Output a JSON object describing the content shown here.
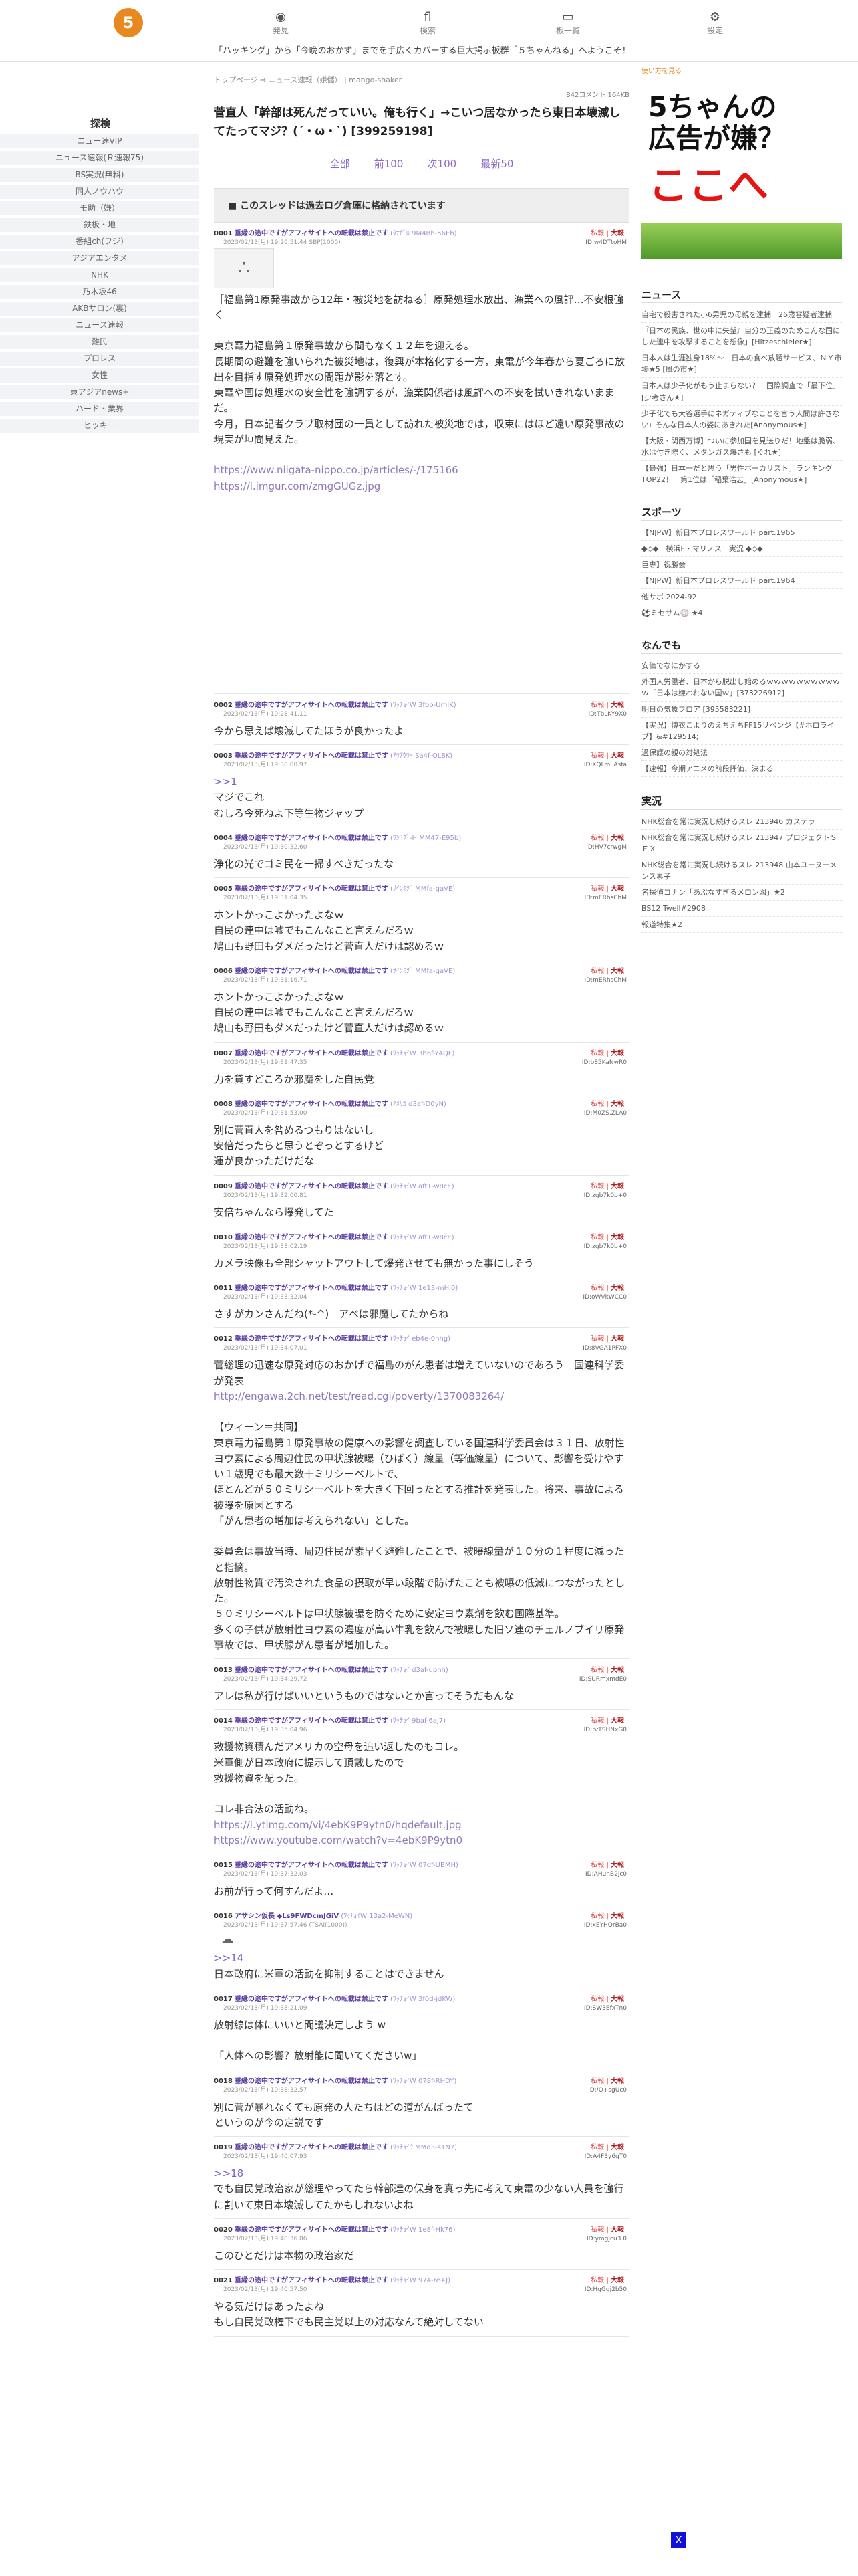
{
  "header": {
    "logo_char": "5",
    "nav": [
      {
        "label": "発見",
        "icon": "◉"
      },
      {
        "label": "検索",
        "icon": "fl"
      },
      {
        "label": "板一覧",
        "icon": "▭"
      },
      {
        "label": "設定",
        "icon": "⚙"
      }
    ],
    "ticker": "「ハッキング」から「今晩のおかず」までを手広くカバーする巨大掲示板群「５ちゃんねる」へようこそ！"
  },
  "left_sidebar": {
    "title": "探検",
    "items": [
      "ニュー速VIP",
      "ニュース速報(Ｒ速報75)",
      "BS実況(無料)",
      "同人ノウハウ",
      "モ助（嫌）",
      "鉄板・地",
      "番組ch(フジ)",
      "アジアエンタメ",
      "NHK",
      "乃木坂46",
      "AKBサロン(裏)",
      "ニュース速報",
      "難民",
      "プロレス",
      "女性",
      "東アジアnews+",
      "ハード・業界",
      "ヒッキー"
    ]
  },
  "main": {
    "breadcrumb": [
      "トップページ",
      "ニュース速報（嫌儲）",
      "mango-shaker"
    ],
    "meta": "842コメント 164KB",
    "title": "菅直人「幹部は死んだっていい。俺も行く」→こいつ居なかったら東日本壊滅してたってマジ？(´・ω・`) [399259198]",
    "jumps": [
      "全部",
      "前100",
      "次100",
      "最新50"
    ],
    "archive_notice": "このスレッドは過去ログ倉庫に格納されています",
    "res_actions": {
      "r1": "私報",
      "r2": "大報"
    },
    "posts": [
      {
        "no": "0001",
        "name": "垂縁の途中ですがアフィサイトへの転載は禁止です",
        "trip": "(ﾀﾅｶﾞﾛ 9M4Bb-56Eh)",
        "date": "2023/02/13(月) 19:20:51.44 SBP(1000)",
        "id": "ID:w4DTtoHM",
        "thumb": "∴",
        "body": [
          "［福島第1原発事故から12年・被災地を訪ねる］原発処理水放出、漁業への風評…不安根強く",
          "",
          "東京電力福島第１原発事故から間もなく１２年を迎える。",
          "長期間の避難を強いられた被災地は，復興が本格化する一方，東電が今年春から夏ごろに放出を目指す原発処理水の問題が影を落とす。",
          "東電や国は処理水の安全性を強調するが，漁業関係者は風評への不安を拭いきれないままだ。",
          "今月，日本記者クラブ取材団の一員として訪れた被災地では，収束にはほど遠い原発事故の現実が垣間見えた。",
          "",
          "https://www.niigata-nippo.co.jp/articles/-/175166",
          "https://i.imgur.com/zmgGUGz.jpg"
        ]
      },
      {
        "no": "0002",
        "name": "垂縁の途中ですがアフィサイトへの転載は禁止です",
        "trip": "(ﾜｯﾁｮｲW 3fbb-UmJK)",
        "date": "2023/02/13(月) 19:28:41.11",
        "id": "ID:TbLKY9X0",
        "body": [
          "今から思えば壊滅してたほうが良かったよ"
        ]
      },
      {
        "no": "0003",
        "name": "垂縁の途中ですがアフィサイトへの転載は禁止です",
        "trip": "(ｱｳｱｳｳｰ Sa4f-QL8K)",
        "date": "2023/02/13(月) 19:30:00.97",
        "id": "ID:KQLmLAsfa",
        "body": [
          ">>1",
          "マジでこれ",
          "むしろ今死ねよ下等生物ジャップ"
        ]
      },
      {
        "no": "0004",
        "name": "垂縁の途中ですがアフィサイトへの転載は禁止です",
        "trip": "(ﾜﾝﾐｸﾞ-H MM47-E95b)",
        "date": "2023/02/13(月) 19:30:32.60",
        "id": "ID:HV7crwgM",
        "body": [
          "浄化の光でゴミ民を一掃すべきだったな"
        ]
      },
      {
        "no": "0005",
        "name": "垂縁の途中ですがアフィサイトへの転載は禁止です",
        "trip": "(ｻｲﾝﾐｸﾞ MMfa-qaVE)",
        "date": "2023/02/13(月) 19:31:04.35",
        "id": "ID:mERhsChM",
        "body": [
          "ホントかっこよかったよなｗ",
          "自民の連中は嘘でもこんなこと言えんだろｗ",
          "鳩山も野田もダメだったけど菅直人だけは認めるｗ"
        ]
      },
      {
        "no": "0006",
        "name": "垂縁の途中ですがアフィサイトへの転載は禁止です",
        "trip": "(ｻｲﾝﾐｸﾞ MMfa-qaVE)",
        "date": "2023/02/13(月) 19:31:16.71",
        "id": "ID:mERhsChM",
        "body": [
          "ホントかっこよかったよなｗ",
          "自民の連中は嘘でもこんなこと言えんだろｗ",
          "鳩山も野田もダメだったけど菅直人だけは認めるｗ"
        ]
      },
      {
        "no": "0007",
        "name": "垂縁の途中ですがアフィサイトへの転載は禁止です",
        "trip": "(ﾜｯﾁｮｲW 3b6f-Y4QF)",
        "date": "2023/02/13(月) 19:31:47.35",
        "id": "ID:b85KaNwR0",
        "body": [
          "力を貸すどころか邪魔をした自民党"
        ]
      },
      {
        "no": "0008",
        "name": "垂縁の途中ですがアフィサイトへの転載は禁止です",
        "trip": "(ｱﾒﾘｶ d3af-D0yN)",
        "date": "2023/02/13(月) 19:31:53.00",
        "id": "ID:M0ZS.ZLA0",
        "body": [
          "別に菅直人を咎めるつもりはないし",
          "安倍だったらと思うとぞっとするけど",
          "運が良かっただけだな"
        ]
      },
      {
        "no": "0009",
        "name": "垂縁の途中ですがアフィサイトへの転載は禁止です",
        "trip": "(ﾜｯﾁｮｲW aft1-w8cE)",
        "date": "2023/02/13(月) 19:32:00.81",
        "id": "ID:zgb7k0b+0",
        "body": [
          "安倍ちゃんなら爆発してた"
        ]
      },
      {
        "no": "0010",
        "name": "垂縁の途中ですがアフィサイトへの転載は禁止です",
        "trip": "(ﾜｯﾁｮｲW aft1-w8cE)",
        "date": "2023/02/13(月) 19:33:02.19",
        "id": "ID:zgb7k0b+0",
        "body": [
          "カメラ映像も全部シャットアウトして爆発させても無かった事にしそう"
        ]
      },
      {
        "no": "0011",
        "name": "垂縁の途中ですがアフィサイトへの転載は禁止です",
        "trip": "(ﾜｯﾁｮｲW 1e13-mHI0)",
        "date": "2023/02/13(月) 19:33:32.04",
        "id": "ID:oWVkWCC0",
        "body": [
          "さすがカンさんだね(*-^)　アベは邪魔してたからね"
        ]
      },
      {
        "no": "0012",
        "name": "垂縁の途中ですがアフィサイトへの転載は禁止です",
        "trip": "(ﾜｯﾁｮｲ eb4e-0hhg)",
        "date": "2023/02/13(月) 19:34:07.01",
        "id": "ID:8VGA1PFX0",
        "body": [
          "菅総理の迅速な原発対応のおかげで福島のがん患者は増えていないのであろう　国連科学委が発表",
          "http://engawa.2ch.net/test/read.cgi/poverty/1370083264/",
          "",
          "【ウィーン＝共同】",
          "東京電力福島第１原発事故の健康への影響を調査している国連科学委員会は３１日、放射性ヨウ素による周辺住民の甲状腺被曝（ひばく）線量（等価線量）について、影響を受けやすい１歳児でも最大数十ミリシーベルトで、",
          "ほとんどが５０ミリシーベルトを大きく下回ったとする推計を発表した。将来、事故による被曝を原因とする",
          "「がん患者の増加は考えられない」とした。",
          "",
          "委員会は事故当時、周辺住民が素早く避難したことで、被曝線量が１０分の１程度に減ったと指摘。",
          "放射性物質で汚染された食品の摂取が早い段階で防げたことも被曝の低減につながったとした。",
          "５０ミリシーベルトは甲状腺被曝を防ぐために安定ヨウ素剤を飲む国際基準。",
          "多くの子供が放射性ヨウ素の濃度が高い牛乳を飲んで被曝した旧ソ連のチェルノブイリ原発事故では、甲状腺がん患者が増加した。"
        ]
      },
      {
        "no": "0013",
        "name": "垂縁の途中ですがアフィサイトへの転載は禁止です",
        "trip": "(ﾜｯﾁｮｲ d3af-uphh)",
        "date": "2023/02/13(月) 19:34:29.72",
        "id": "ID:SURmxmdE0",
        "body": [
          "アレは私が行けばいいというものではないとか言ってそうだもんな"
        ]
      },
      {
        "no": "0014",
        "name": "垂縁の途中ですがアフィサイトへの転載は禁止です",
        "trip": "(ﾜｯﾁｮｲ 9baf-6aj7)",
        "date": "2023/02/13(月) 19:35:04.96",
        "id": "ID:rvTSHNxG0",
        "body": [
          "救援物資積んだアメリカの空母を追い返したのもコレ。",
          "米軍側が日本政府に提示して頂戴したので",
          "救援物資を配った。",
          "",
          "コレ非合法の活動ね。",
          "https://i.ytimg.com/vi/4ebK9P9ytn0/hqdefault.jpg",
          "https://www.youtube.com/watch?v=4ebK9P9ytn0"
        ]
      },
      {
        "no": "0015",
        "name": "垂縁の途中ですがアフィサイトへの転載は禁止です",
        "trip": "(ﾜｯﾁｮｲW 07df-UBMH)",
        "date": "2023/02/13(月) 19:37:32.03",
        "id": "ID:AHunB2jc0",
        "body": [
          "お前が行って何すんだよ…"
        ]
      },
      {
        "no": "0016",
        "name": "アサシン仮長 ◆Ls9FWDcmJGiV",
        "trip": "(ﾜｯﾁｮｲW 13a2-MeWN)",
        "date": "2023/02/13(月) 19:37:57.46 (TSAI(1000))",
        "id": "ID:xEYHQrBa0",
        "thumb": "☁",
        "body": [
          ">>14",
          "日本政府に米軍の活動を抑制することはできません"
        ]
      },
      {
        "no": "0017",
        "name": "垂縁の途中ですがアフィサイトへの転載は禁止です",
        "trip": "(ﾜｯﾁｮｲW 3f0d-jdKW)",
        "date": "2023/02/13(月) 19:38:21.09",
        "id": "ID:SW3EfxTn0",
        "body": [
          "放射線は体にいいと聞議決定しよう w",
          "",
          "「人体への影響？放射能に聞いてくださいw」"
        ]
      },
      {
        "no": "0018",
        "name": "垂縁の途中ですがアフィサイトへの転載は禁止です",
        "trip": "(ﾜｯﾁｮｲW 078f-RHDY)",
        "date": "2023/02/13(月) 19:38:32.57",
        "id": "ID:/O+sgUc0",
        "body": [
          "別に菅が暴れなくても原発の人たちはどの道がんばったて",
          "というのが今の定説です"
        ]
      },
      {
        "no": "0019",
        "name": "垂縁の途中ですがアフィサイトへの転載は禁止です",
        "trip": "(ﾜｯﾁｮｲｳ MMd3-s1N7)",
        "date": "2023/02/13(月) 19:40:07.93",
        "id": "ID:A4F3y6qT0",
        "body": [
          ">>18",
          "でも自民党政治家が総理やってたら幹部達の保身を真っ先に考えて東電の少ない人員を強行に割いて東日本壊滅してたかもしれないよね"
        ]
      },
      {
        "no": "0020",
        "name": "垂縁の途中ですがアフィサイトへの転載は禁止です",
        "trip": "(ﾜｯﾁｮｲW 1e8f-Hk76)",
        "date": "2023/02/13(月) 19:40:36.06",
        "id": "ID:ymgJcu3.0",
        "body": [
          "このひとだけは本物の政治家だ"
        ]
      },
      {
        "no": "0021",
        "name": "垂縁の途中ですがアフィサイトへの転載は禁止です",
        "trip": "(ﾜｯﾁｮｲW 974-re+J)",
        "date": "2023/02/13(月) 19:40:57.50",
        "id": "ID:HgGgj2b50",
        "body": [
          "やる気だけはあったよね",
          "もし自民党政権下でも民主党以上の対応なんて絶対してない"
        ]
      }
    ]
  },
  "right_sidebar": {
    "ad_tag": "使い方を見る",
    "ad_line1": "5ちゃんの",
    "ad_line2": "広告が嫌？",
    "ad_line3": "ここへ",
    "news_title": "ニュース",
    "news": [
      "自宅で殺害された小6男児の母親を逮捕　26歳容疑者逮捕",
      "『日本の民族、世の中に失望』自分の正義のためこんな国にした連中を攻撃することを想像」[Hitzeschleier★]",
      "日本人は生涯独身18%〜　日本の食べ放題サービス、ＮＹ市場★5 [風の市★]",
      "日本人は少子化がもう止まらない？　国際調査で「最下位」[少考さん★]",
      "少子化でも大谷選手にネガティブなことを言う人間は許さない←そんな日本人の姿にあきれた[Anonymous★]",
      "【大阪・関西万博】ついに参加国を見送りだ！地盤は脆弱、水は付き際く、メタンガス爆さも [ぐれ★]",
      "【最強】日本一だと思う「男性ボーカリスト」ランキングTOP22！　第1位は「稲葉浩志」[Anonymous★]"
    ],
    "sports_title": "スポーツ",
    "sports": [
      "【NJPW】新日本プロレスワールド part.1965",
      "◆◇◆　横浜F・マリノス　実況 ◆◇◆",
      "巨専】祝勝会",
      "【NJPW】新日本プロレスワールド part.1964",
      "他サポ 2024-92",
      "⚽ミセサム🏐 ★4"
    ],
    "misc_title": "なんでも",
    "misc": [
      "安価でなにかする",
      "外国人労働者、日本から脱出し始めるｗｗｗｗｗｗｗｗｗｗｗ「日本は嫌われない国ｗ」[373226912]",
      "明日の気象フロア [395583221]",
      "【実況】博衣こよりのえちえちFF15リベンジ【#ホロライブ】&#129514;",
      "過保護の親の対処法",
      "【速報】今期アニメの前段評価、決まる"
    ],
    "live_title": "実況",
    "live": [
      "NHK総合を常に実況し続けるスレ 213946 カステラ",
      "NHK総合を常に実況し続けるスレ 213947 プロジェクトＳＥＸ",
      "NHK総合を常に実況し続けるスレ 213948 山本ユーヌーメンス素子",
      "名探偵コナン「あぶなすぎるメロン図」★2",
      "BS12 Twell#2908",
      "報道特集★2"
    ]
  },
  "close_box": "X"
}
